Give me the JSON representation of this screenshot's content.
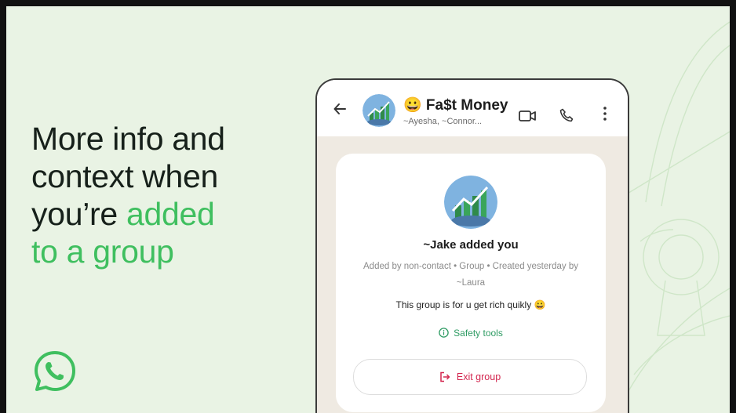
{
  "promo": {
    "headline_line1": "More info and",
    "headline_line2": "context when",
    "headline_line3_pre": "you’re ",
    "headline_line3_accent": "added",
    "headline_line4_accent": "to a group",
    "accent_color": "#3fbf5f",
    "logo_icon": "whatsapp-logo-icon"
  },
  "chat": {
    "title": "😀 Fa$t Money",
    "subtitle": "~Ayesha, ~Connor...",
    "icons": [
      "back-arrow-icon",
      "video-call-icon",
      "voice-call-icon",
      "more-options-icon"
    ]
  },
  "card": {
    "added_title": "~Jake added you",
    "meta": "Added by non-contact • Group • Created yesterday by ~Laura",
    "description": "This group is for u get rich quikly 😀",
    "safety_label": "Safety tools",
    "exit_label": "Exit group",
    "exit_color": "#d3264f",
    "safety_color": "#2e9b63"
  }
}
